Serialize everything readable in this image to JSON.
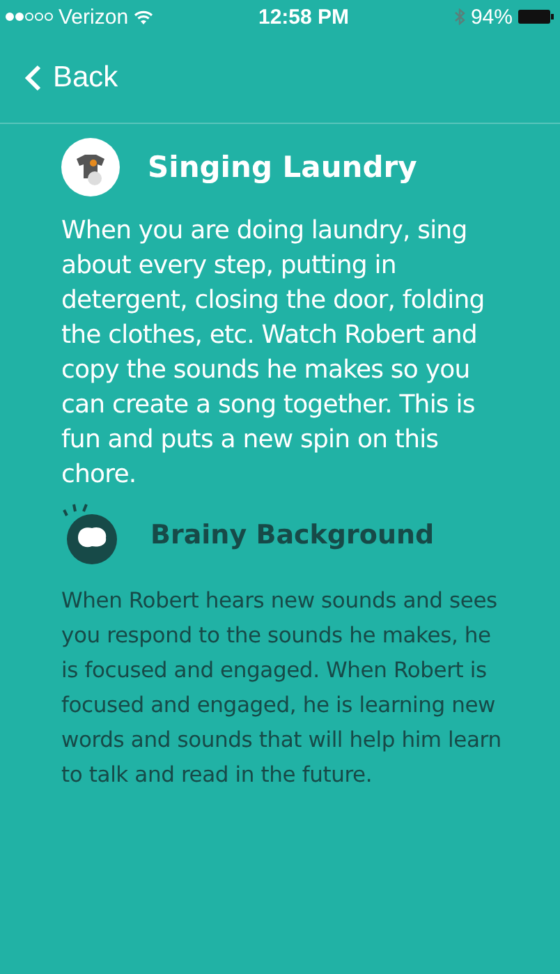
{
  "status_bar": {
    "carrier": "Verizon",
    "time": "12:58 PM",
    "battery": "94%"
  },
  "nav": {
    "back": "Back"
  },
  "activity": {
    "title": "Singing Laundry",
    "text": "When you are doing laundry, sing about every step, putting in detergent, closing the door, folding the clothes, etc. Watch Robert and copy the sounds he makes so you can create a song together. This is fun and puts a new spin on this chore."
  },
  "background": {
    "title": "Brainy Background",
    "text": "When Robert hears new sounds and sees you respond to the sounds he makes, he is focused and engaged. When Robert is focused and engaged, he is learning new words and sounds that will help him learn to talk and read in the future."
  }
}
